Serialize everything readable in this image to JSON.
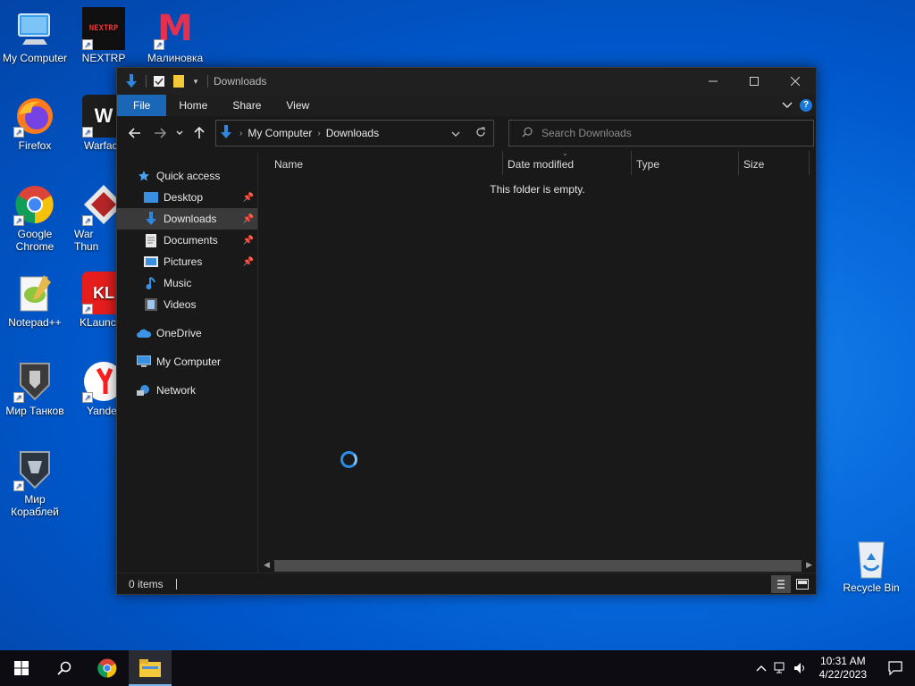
{
  "desktop": {
    "icons": [
      {
        "label": "My Computer"
      },
      {
        "label": "NEXTRP"
      },
      {
        "label": "Малиновка"
      },
      {
        "label": "Firefox"
      },
      {
        "label": "Warfac"
      },
      {
        "label": "Google Chrome"
      },
      {
        "label": "War Thun"
      },
      {
        "label": "Notepad++"
      },
      {
        "label": "KLaunc"
      },
      {
        "label": "Мир Танков"
      },
      {
        "label": "Yande"
      },
      {
        "label": "Мир Кораблей"
      },
      {
        "label": "Recycle Bin"
      }
    ],
    "nextrp_logo_text": "NEXTRP",
    "malinovka_logo_text": "M",
    "klauncher_logo_text": "KL"
  },
  "window": {
    "title": "Downloads",
    "ribbon_tabs": [
      {
        "label": "File"
      },
      {
        "label": "Home"
      },
      {
        "label": "Share"
      },
      {
        "label": "View"
      }
    ],
    "address": {
      "crumbs": [
        {
          "label": "My Computer"
        },
        {
          "label": "Downloads"
        }
      ]
    },
    "search": {
      "placeholder": "Search Downloads"
    },
    "nav_pane": [
      {
        "label": "Quick access"
      },
      {
        "label": "Desktop"
      },
      {
        "label": "Downloads"
      },
      {
        "label": "Documents"
      },
      {
        "label": "Pictures"
      },
      {
        "label": "Music"
      },
      {
        "label": "Videos"
      },
      {
        "label": "OneDrive"
      },
      {
        "label": "My Computer"
      },
      {
        "label": "Network"
      }
    ],
    "columns": [
      {
        "label": "Name"
      },
      {
        "label": "Date modified"
      },
      {
        "label": "Type"
      },
      {
        "label": "Size"
      }
    ],
    "empty_message": "This folder is empty.",
    "status": {
      "items": "0 items"
    }
  },
  "taskbar": {
    "time": "10:31 AM",
    "date": "4/22/2023"
  },
  "colors": {
    "accent": "#1a67b8",
    "window_bg": "#191919",
    "folder_yellow": "#f3c83b",
    "download_blue": "#2e86de"
  }
}
